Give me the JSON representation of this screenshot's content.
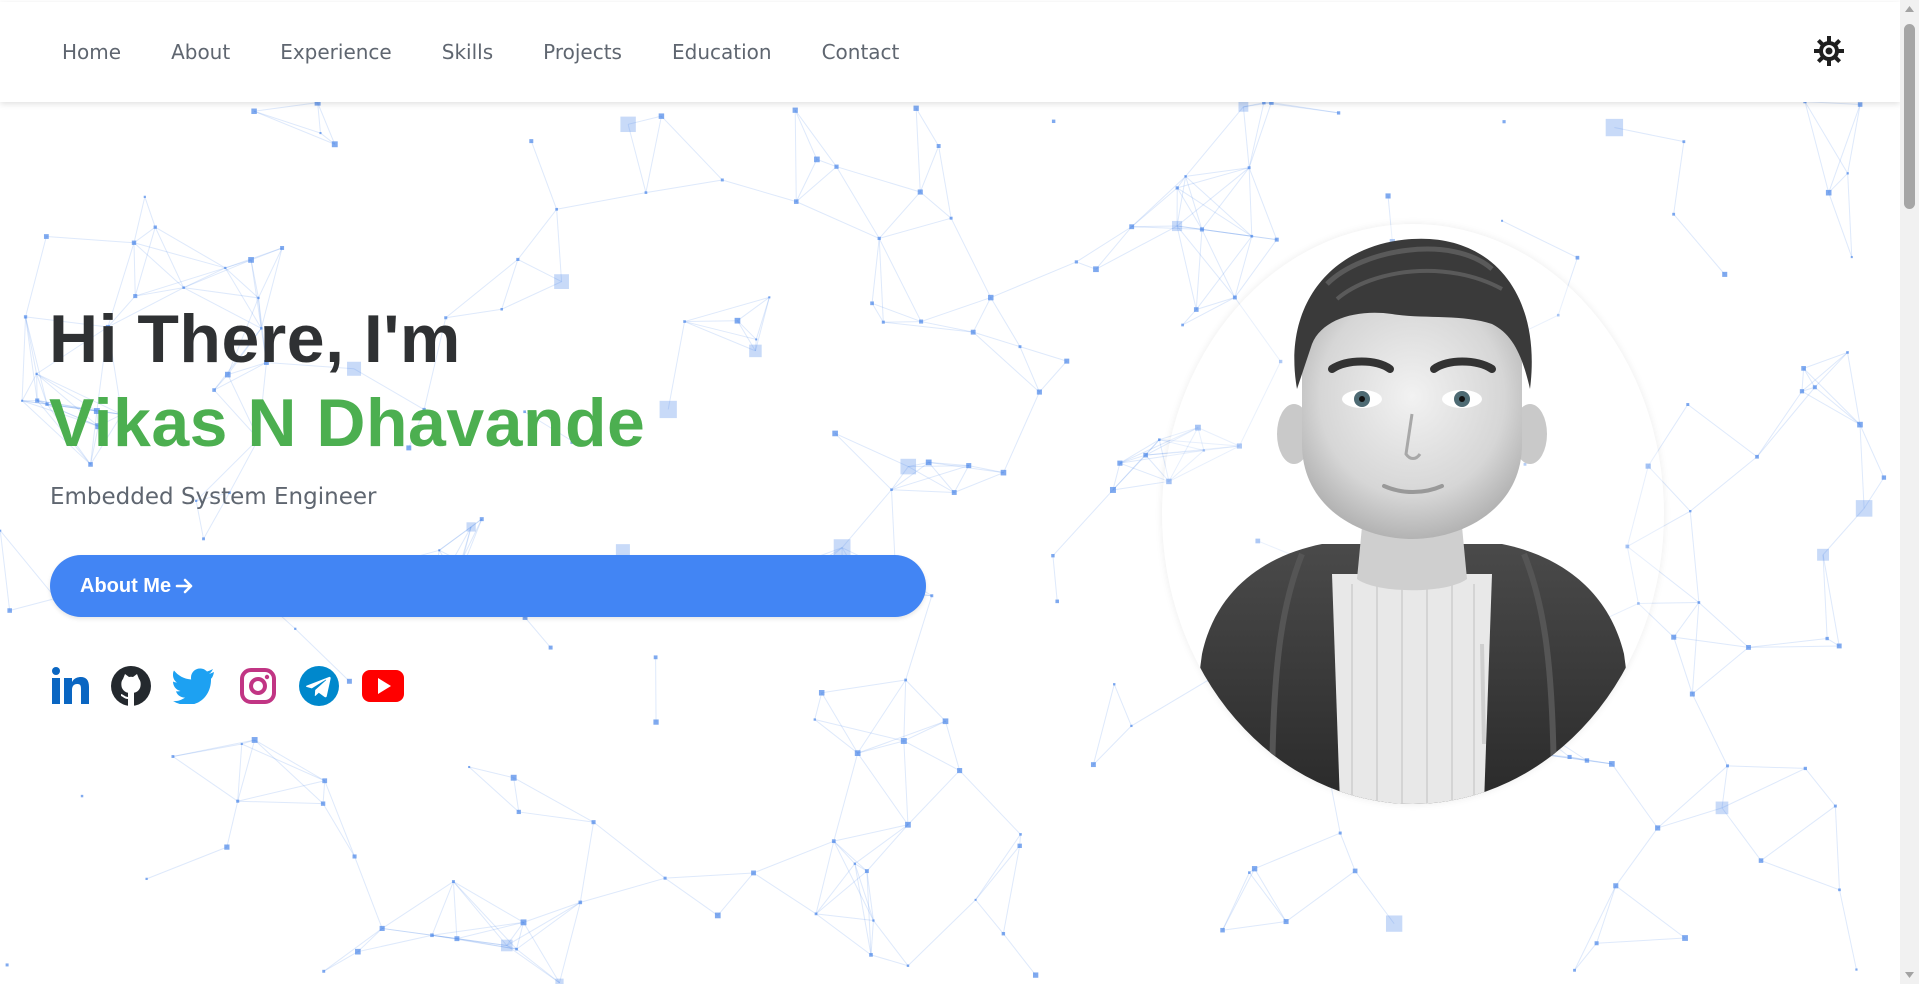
{
  "nav": {
    "items": [
      {
        "label": "Home"
      },
      {
        "label": "About"
      },
      {
        "label": "Experience"
      },
      {
        "label": "Skills"
      },
      {
        "label": "Projects"
      },
      {
        "label": "Education"
      },
      {
        "label": "Contact"
      }
    ],
    "theme_toggle_icon": "gear-icon"
  },
  "hero": {
    "greeting": "Hi There, I'm",
    "name": "Vikas N Dhavande",
    "role": "Embedded System Engineer",
    "cta_label": "About Me",
    "cta_icon": "arrow-right-icon"
  },
  "socials": [
    {
      "name": "linkedin-icon",
      "color": "#0a66c2"
    },
    {
      "name": "github-icon",
      "color": "#24292e"
    },
    {
      "name": "twitter-icon",
      "color": "#1da1f2"
    },
    {
      "name": "instagram-icon",
      "color": "#c13584"
    },
    {
      "name": "telegram-icon",
      "color": "#0088cc"
    },
    {
      "name": "youtube-icon",
      "color": "#ff0000"
    }
  ],
  "colors": {
    "accent_green": "#4caf50",
    "button_blue": "#4285f4",
    "particle_blue": "#4a86e8"
  },
  "avatar": {
    "description_icon": "avatar-illustration"
  }
}
